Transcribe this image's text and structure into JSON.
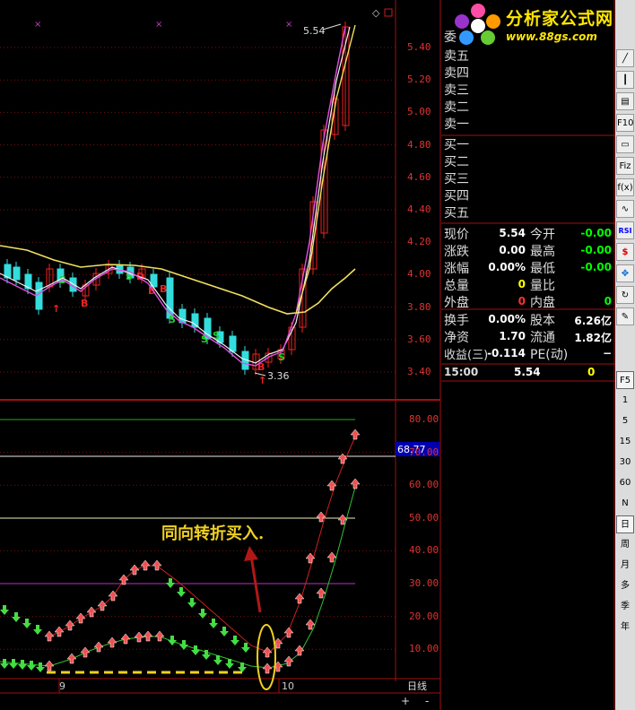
{
  "logo": {
    "title": "分析家公式网",
    "url": "www.88gs.com"
  },
  "price_axis": [
    "5.40",
    "5.20",
    "5.00",
    "4.80",
    "4.60",
    "4.40",
    "4.20",
    "4.00",
    "3.80",
    "3.60",
    "3.40"
  ],
  "indicator_axis": [
    "80.00",
    "70.00",
    "60.00",
    "50.00",
    "40.00",
    "30.00",
    "20.00",
    "10.00"
  ],
  "indicator_current": "68.77",
  "price_high_label": "5.54",
  "price_low_label": "3.36",
  "annotation": "同向转折买入.",
  "date_labels": {
    "sep": "9",
    "oct": "10"
  },
  "period_label": "日线",
  "bottom_buttons": [
    "+",
    "-"
  ],
  "orderbook": {
    "header": "委",
    "sell": [
      "卖五",
      "卖四",
      "卖三",
      "卖二",
      "卖一"
    ],
    "buy": [
      "买一",
      "买二",
      "买三",
      "买四",
      "买五"
    ]
  },
  "quote": [
    {
      "l1": "现价",
      "v1": "5.54",
      "c1": "#ffffff",
      "l2": "今开",
      "v2": "-0.00",
      "c2": "#00ff00"
    },
    {
      "l1": "涨跌",
      "v1": "0.00",
      "c1": "#ffffff",
      "l2": "最高",
      "v2": "-0.00",
      "c2": "#00ff00"
    },
    {
      "l1": "涨幅",
      "v1": "0.00%",
      "c1": "#ffffff",
      "l2": "最低",
      "v2": "-0.00",
      "c2": "#00ff00"
    },
    {
      "l1": "总量",
      "v1": "0",
      "c1": "#ffff00",
      "l2": "量比",
      "v2": "",
      "c2": "#ffffff"
    },
    {
      "l1": "外盘",
      "v1": "0",
      "c1": "#ff3030",
      "l2": "内盘",
      "v2": "0",
      "c2": "#00ff00"
    }
  ],
  "finance": [
    {
      "l1": "换手",
      "v1": "0.00%",
      "l2": "股本",
      "v2": "6.26亿"
    },
    {
      "l1": "净资",
      "v1": "1.70",
      "l2": "流通",
      "v2": "1.82亿"
    },
    {
      "l1": "收益(三)",
      "v1": "-0.114",
      "l2": "PE(动)",
      "v2": "−"
    }
  ],
  "tick": {
    "time": "15:00",
    "price": "5.54",
    "vol": "0"
  },
  "toolbar": [
    "F5",
    "1",
    "5",
    "15",
    "30",
    "60",
    "N",
    "日",
    "周",
    "月",
    "多",
    "季",
    "年"
  ],
  "toolbar_icons": [
    "line-chart-icon",
    "candle-icon",
    "table-icon",
    "f10-icon",
    "document-icon",
    "fiz-icon",
    "fx-icon",
    "wave-icon",
    "rsi-icon",
    "dollar-icon",
    "move-icon",
    "refresh-icon",
    "pencil-icon"
  ],
  "toolbar_icon_text": {
    "f10": "F10",
    "fiz": "Fiz",
    "fx": "f(x)",
    "rsi": "RSI",
    "dollar": "$"
  }
}
